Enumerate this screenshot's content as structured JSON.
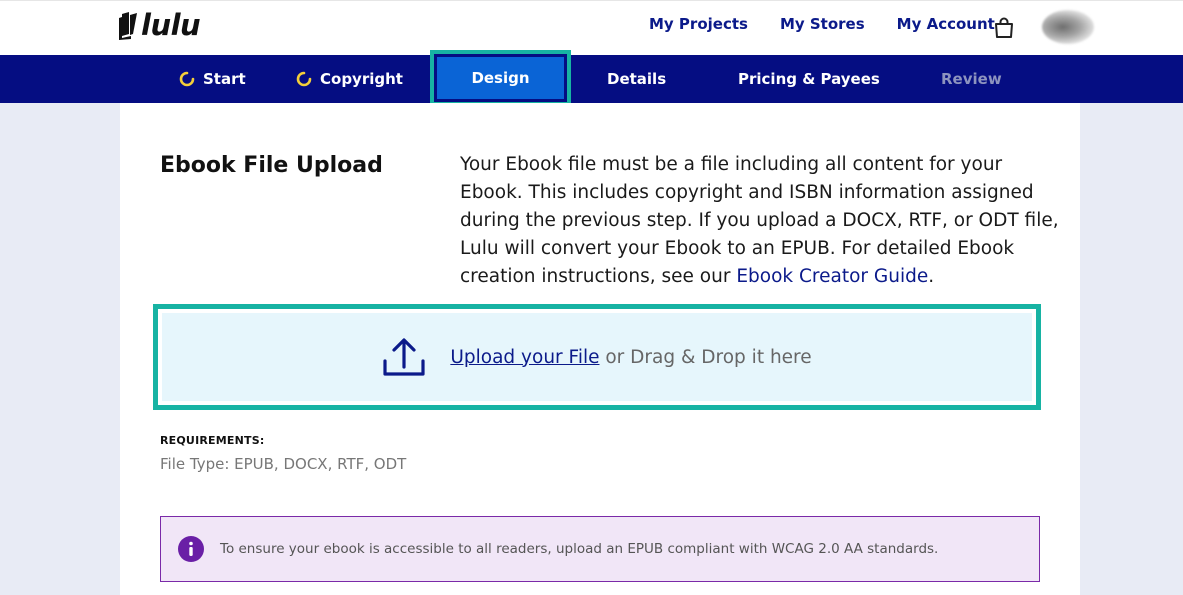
{
  "header": {
    "logo_text": "lulu",
    "nav": [
      "My Projects",
      "My Stores",
      "My Account"
    ]
  },
  "steps": [
    {
      "label": "Start",
      "state": "in-progress"
    },
    {
      "label": "Copyright",
      "state": "in-progress"
    },
    {
      "label": "Design",
      "state": "active"
    },
    {
      "label": "Details",
      "state": "default"
    },
    {
      "label": "Pricing & Payees",
      "state": "default"
    },
    {
      "label": "Review",
      "state": "disabled"
    }
  ],
  "main": {
    "title": "Ebook File Upload",
    "description": "Your Ebook file must be a file including all content for your Ebook. This includes copyright and ISBN information assigned during the previous step. If you upload a DOCX, RTF, or ODT file, Lulu will convert your Ebook to an EPUB. For detailed Ebook creation instructions, see our ",
    "description_link": "Ebook Creator Guide",
    "description_end": ".",
    "dropzone": {
      "link": "Upload your File",
      "text": " or Drag & Drop it here"
    },
    "requirements_label": "REQUIREMENTS:",
    "requirements_value": "File Type: EPUB, DOCX, RTF, ODT",
    "info": "To ensure your ebook is accessible to all readers, upload an EPUB compliant with WCAG 2.0 AA standards."
  },
  "colors": {
    "navy": "#050d82",
    "active_step": "#0a64d6",
    "highlight": "#17b3a3",
    "link": "#0b1a8a",
    "info_bg": "#f1e6f7",
    "info_border": "#7a2aa8",
    "dropzone_bg": "#e6f6fc"
  }
}
